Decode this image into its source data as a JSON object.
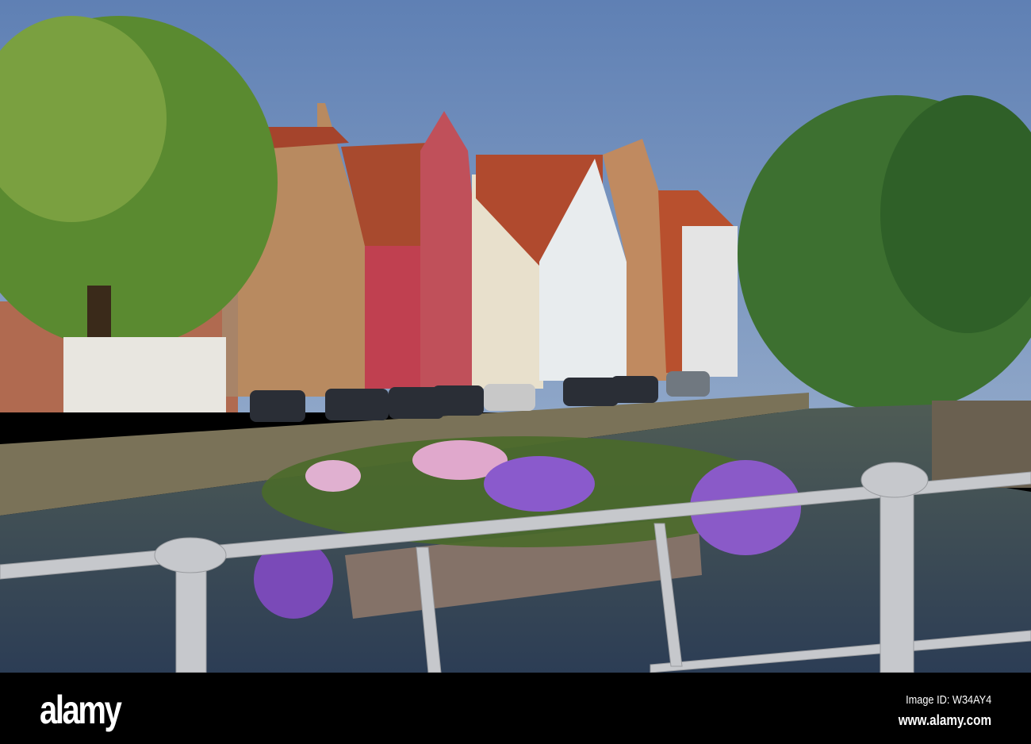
{
  "footer": {
    "logo": "alamy",
    "image_id": "Image ID: W34AY4",
    "url": "www.alamy.com"
  },
  "colors": {
    "sky": "#6a88b8",
    "water": "#3a4a5a",
    "roof": "#b04a2a",
    "tree": "#4a7a2a"
  }
}
